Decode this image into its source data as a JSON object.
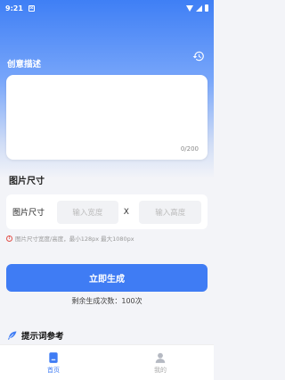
{
  "status_bar": {
    "time": "9:21"
  },
  "creative": {
    "title": "创意描述",
    "textarea_placeholder": "",
    "char_count": "0/200"
  },
  "size": {
    "section_title": "图片尺寸",
    "label": "图片尺寸",
    "width_placeholder": "输入宽度",
    "separator": "X",
    "height_placeholder": "输入高度",
    "hint": "图片尺寸宽度/高度，最小128px 最大1080px"
  },
  "generate": {
    "button_label": "立即生成",
    "remaining": "剩余生成次数：100次"
  },
  "prompt_ref": {
    "label": "提示词参考"
  },
  "tabbar": {
    "items": [
      {
        "label": "首页",
        "icon": "home-icon",
        "active": true
      },
      {
        "label": "我的",
        "icon": "user-icon",
        "active": false
      }
    ]
  },
  "colors": {
    "accent": "#3f7cf4",
    "warning": "#e2534c"
  }
}
